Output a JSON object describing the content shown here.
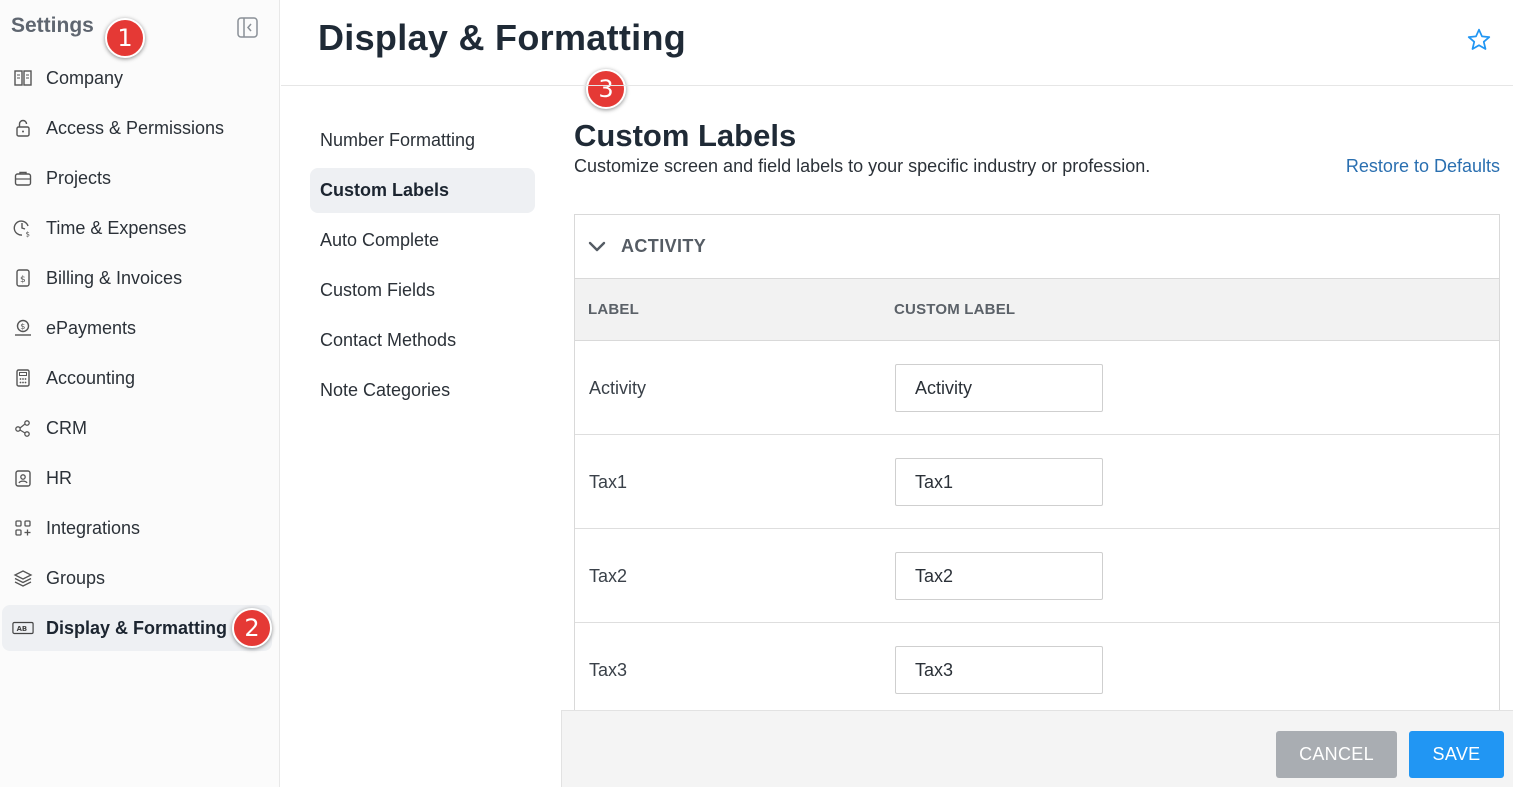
{
  "sidebar": {
    "title": "Settings",
    "items": [
      {
        "label": "Company",
        "icon": "building-icon"
      },
      {
        "label": "Access & Permissions",
        "icon": "lock-icon"
      },
      {
        "label": "Projects",
        "icon": "briefcase-icon"
      },
      {
        "label": "Time & Expenses",
        "icon": "clock-dollar-icon"
      },
      {
        "label": "Billing & Invoices",
        "icon": "invoice-icon"
      },
      {
        "label": "ePayments",
        "icon": "payment-icon"
      },
      {
        "label": "Accounting",
        "icon": "calculator-icon"
      },
      {
        "label": "CRM",
        "icon": "network-icon"
      },
      {
        "label": "HR",
        "icon": "id-badge-icon"
      },
      {
        "label": "Integrations",
        "icon": "grid-plus-icon"
      },
      {
        "label": "Groups",
        "icon": "layers-icon"
      },
      {
        "label": "Display & Formatting",
        "icon": "ab-icon",
        "active": true
      }
    ]
  },
  "markers": [
    "1",
    "2",
    "3"
  ],
  "header": {
    "title": "Display & Formatting"
  },
  "subnav": {
    "items": [
      {
        "label": "Number Formatting"
      },
      {
        "label": "Custom Labels",
        "active": true
      },
      {
        "label": "Auto Complete"
      },
      {
        "label": "Custom Fields"
      },
      {
        "label": "Contact Methods"
      },
      {
        "label": "Note Categories"
      }
    ]
  },
  "content": {
    "title": "Custom Labels",
    "description": "Customize screen and field labels to your specific industry or profession.",
    "restore_label": "Restore to Defaults",
    "panel": {
      "title": "ACTIVITY",
      "columns": [
        "LABEL",
        "CUSTOM LABEL"
      ],
      "rows": [
        {
          "label": "Activity",
          "value": "Activity"
        },
        {
          "label": "Tax1",
          "value": "Tax1"
        },
        {
          "label": "Tax2",
          "value": "Tax2"
        },
        {
          "label": "Tax3",
          "value": "Tax3"
        }
      ]
    }
  },
  "footer": {
    "cancel_label": "CANCEL",
    "save_label": "SAVE"
  },
  "colors": {
    "accent": "#2196f3",
    "link": "#2a6fb0",
    "marker": "#e53935",
    "cancel": "#a9adb2"
  }
}
